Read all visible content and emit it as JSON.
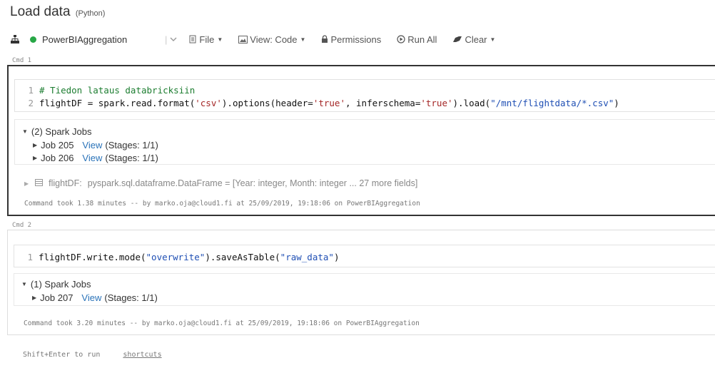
{
  "page": {
    "title": "Load data",
    "language": "(Python)"
  },
  "toolbar": {
    "cluster_name": "PowerBIAggregation",
    "cluster_status_color": "#27a746",
    "file_label": "File",
    "view_label": "View: Code",
    "permissions_label": "Permissions",
    "run_all_label": "Run All",
    "clear_label": "Clear"
  },
  "cells": [
    {
      "cmd": "Cmd 1",
      "code_lines": [
        {
          "n": "1",
          "comment": "# Tiedon lataus databricksiin"
        },
        {
          "n": "2",
          "p1": "flightDF = spark.read.format(",
          "s1": "'csv'",
          "p2": ").options(header=",
          "s2": "'true'",
          "p3": ", inferschema=",
          "s3": "'true'",
          "p4": ").load(",
          "s4": "\"/mnt/flightdata/*.csv\"",
          "p5": ")"
        }
      ],
      "jobs_header": "(2) Spark Jobs",
      "jobs": [
        {
          "name": "Job 205",
          "link": "View",
          "stages": "(Stages: 1/1)"
        },
        {
          "name": "Job 206",
          "link": "View",
          "stages": "(Stages: 1/1)"
        }
      ],
      "dataframe": {
        "name": "flightDF:",
        "schema": "pyspark.sql.dataframe.DataFrame = [Year: integer, Month: integer ... 27 more fields]"
      },
      "took": "Command took 1.38 minutes -- by marko.oja@cloud1.fi at 25/09/2019, 19:18:06 on PowerBIAggregation"
    },
    {
      "cmd": "Cmd 2",
      "code_lines": [
        {
          "n": "1",
          "p1": "flightDF.write.mode(",
          "s1": "\"overwrite\"",
          "p2": ").saveAsTable(",
          "s2": "\"raw_data\"",
          "p3": ")"
        }
      ],
      "jobs_header": "(1) Spark Jobs",
      "jobs": [
        {
          "name": "Job 207",
          "link": "View",
          "stages": "(Stages: 1/1)"
        }
      ],
      "took": "Command took 3.20 minutes -- by marko.oja@cloud1.fi at 25/09/2019, 19:18:06 on PowerBIAggregation"
    }
  ],
  "footer": {
    "hint": "Shift+Enter to run",
    "shortcuts": "shortcuts"
  },
  "icons": {
    "cluster": "cluster-tree-icon",
    "file": "file-icon",
    "view": "image-icon",
    "permissions": "lock-icon",
    "run_all": "play-circle-icon",
    "clear": "eraser-icon"
  }
}
